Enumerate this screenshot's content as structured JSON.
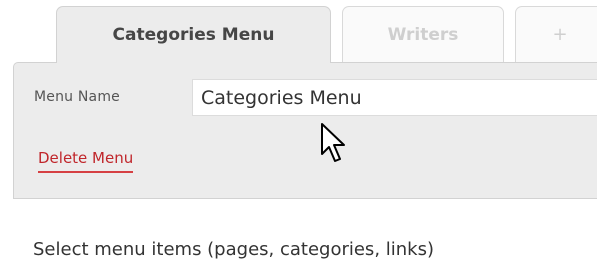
{
  "tabs": [
    {
      "label": "Categories Menu",
      "active": true
    },
    {
      "label": "Writers",
      "active": false
    },
    {
      "label": "+",
      "active": false
    }
  ],
  "menu_header": {
    "name_label": "Menu Name",
    "name_value": "Categories Menu",
    "delete_label": "Delete Menu"
  },
  "body": {
    "instructions": "Select menu items (pages, categories, links)"
  },
  "icons": {
    "cursor": "mouse-pointer-icon"
  },
  "colors": {
    "panel_bg": "#ececec",
    "delete_link": "#c0262b",
    "inactive_tab_text": "#cfcfcf"
  }
}
